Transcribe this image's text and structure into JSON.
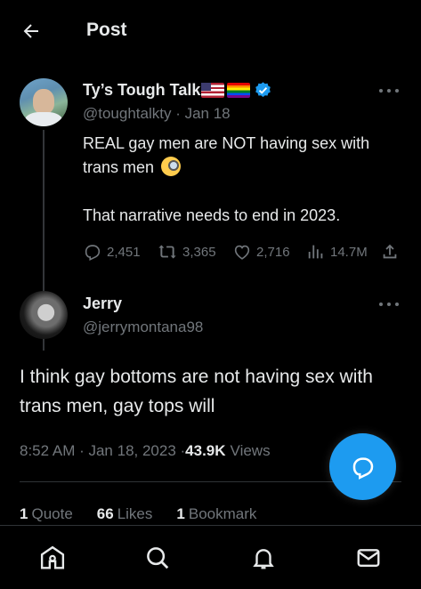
{
  "header": {
    "title": "Post"
  },
  "parent_post": {
    "name": "Ty’s Tough Talk",
    "handle_date": "@toughtalkty · Jan 18",
    "text_line1": "REAL gay men are NOT having sex with trans men",
    "text_line2": "That narrative needs to end in 2023.",
    "replies": "2,451",
    "reposts": "3,365",
    "likes": "2,716",
    "views": "14.7M"
  },
  "reply_post": {
    "name": "Jerry",
    "handle": "@jerrymontana98",
    "text": "I think gay bottoms are not having sex with trans men, gay tops will",
    "time_date": "8:52 AM · Jan 18, 2023 · ",
    "views_count": "43.9K",
    "views_label": "Views",
    "quotes_count": "1",
    "quotes_label": "Quote",
    "likes_count": "66",
    "likes_label": "Likes",
    "bookmarks_count": "1",
    "bookmarks_label": "Bookmark"
  },
  "colors": {
    "accent": "#1d9bf0",
    "muted": "#71767b",
    "text": "#e7e9ea",
    "background": "#000000"
  },
  "icons": [
    "back-arrow-icon",
    "verified-badge-icon",
    "more-icon",
    "reply-icon",
    "repost-icon",
    "like-icon",
    "views-icon",
    "share-icon",
    "compose-reply-icon",
    "home-icon",
    "search-icon",
    "notifications-icon",
    "messages-icon"
  ]
}
